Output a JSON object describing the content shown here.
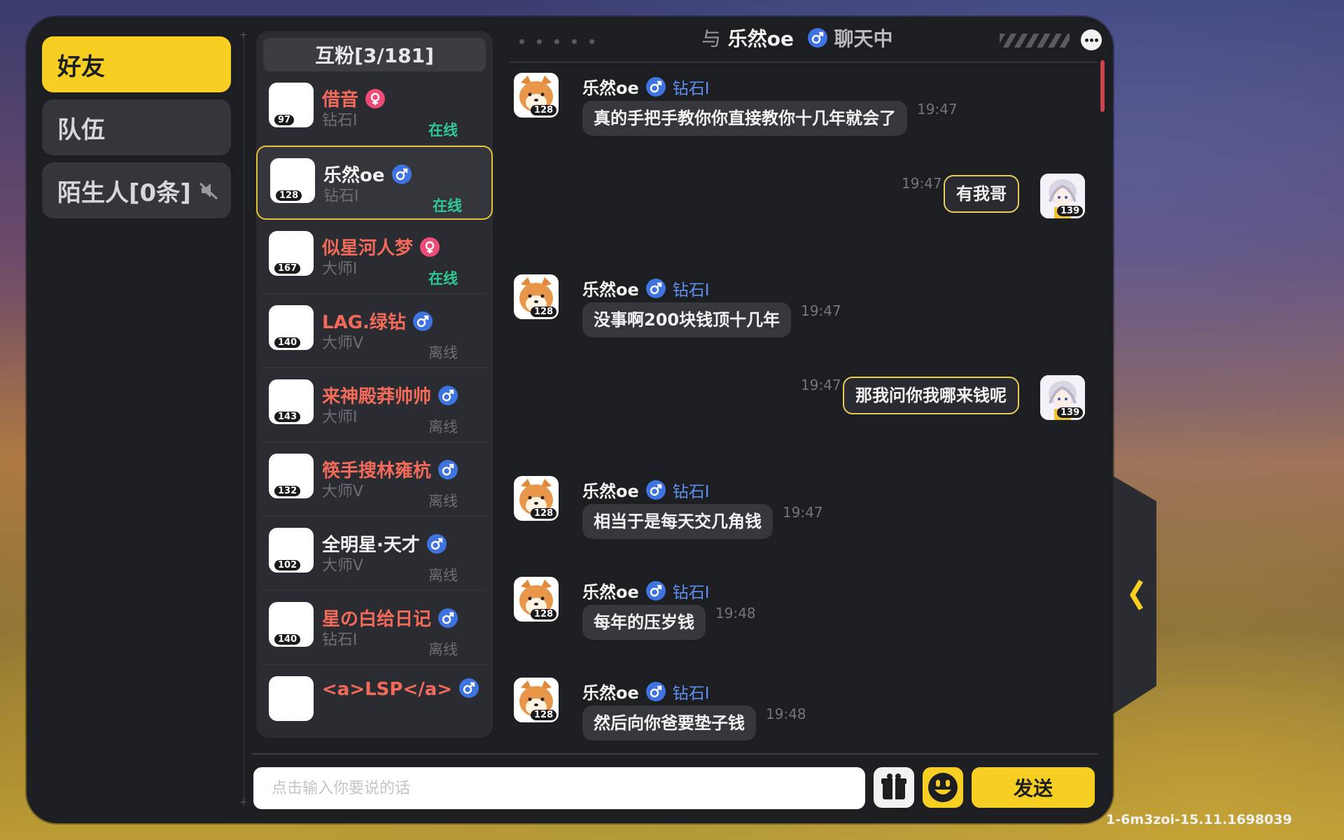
{
  "tabs": [
    {
      "label": "好友"
    },
    {
      "label": "队伍"
    },
    {
      "label": "陌生人[0条]"
    }
  ],
  "friend_list": {
    "header": "互粉[3/181]",
    "friends": [
      {
        "name": "借音",
        "rank": "钻石I",
        "status": "在线",
        "level": "97",
        "gender": "female"
      },
      {
        "name": "乐然oe",
        "rank": "钻石I",
        "status": "在线",
        "level": "128",
        "gender": "male"
      },
      {
        "name": "似星河人梦",
        "rank": "大师I",
        "status": "在线",
        "level": "167",
        "gender": "female"
      },
      {
        "name": "LAG.绿钻",
        "rank": "大师V",
        "status": "离线",
        "level": "140",
        "gender": "male"
      },
      {
        "name": "来神殿莽帅帅",
        "rank": "大师I",
        "status": "离线",
        "level": "143",
        "gender": "male"
      },
      {
        "name": "筷手搜林雍杭",
        "rank": "大师V",
        "status": "离线",
        "level": "132",
        "gender": "male"
      },
      {
        "name": "全明星·天才",
        "rank": "大师V",
        "status": "离线",
        "level": "102",
        "gender": "male"
      },
      {
        "name": "星の白给日记",
        "rank": "钻石I",
        "status": "离线",
        "level": "140",
        "gender": "male"
      },
      {
        "name": "<a>LSP</a>",
        "rank": "",
        "status": "",
        "level": "",
        "gender": "male"
      }
    ]
  },
  "chat": {
    "title_prefix": "与",
    "partner_name": "乐然oe",
    "title_suffix": "聊天中",
    "messages": [
      {
        "sender": "乐然oe",
        "rank": "钻石I",
        "text": "真的手把手教你你直接教你十几年就会了",
        "time": "19:47",
        "mine": false,
        "level": "128"
      },
      {
        "sender": "",
        "rank": "",
        "text": "有我哥",
        "time": "19:47",
        "mine": true,
        "level": "139"
      },
      {
        "sender": "乐然oe",
        "rank": "钻石I",
        "text": "没事啊200块钱顶十几年",
        "time": "19:47",
        "mine": false,
        "level": "128"
      },
      {
        "sender": "",
        "rank": "",
        "text": "那我问你我哪来钱呢",
        "time": "19:47",
        "mine": true,
        "level": "139"
      },
      {
        "sender": "乐然oe",
        "rank": "钻石I",
        "text": "相当于是每天交几角钱",
        "time": "19:47",
        "mine": false,
        "level": "128"
      },
      {
        "sender": "乐然oe",
        "rank": "钻石I",
        "text": "每年的压岁钱",
        "time": "19:48",
        "mine": false,
        "level": "128"
      },
      {
        "sender": "乐然oe",
        "rank": "钻石I",
        "text": "然后向你爸要垫子钱",
        "time": "19:48",
        "mine": false,
        "level": "128"
      }
    ]
  },
  "composer": {
    "placeholder": "点击输入你要说的话",
    "send_label": "发送"
  },
  "version": "1-6m3zoi-15.11.1698039",
  "colors": {
    "accent": "#f7cf22",
    "online": "#2fc894",
    "male": "#3f73e0",
    "female": "#ee4b77",
    "name_red": "#f26b5a",
    "rank_blue": "#5f8ff0"
  }
}
